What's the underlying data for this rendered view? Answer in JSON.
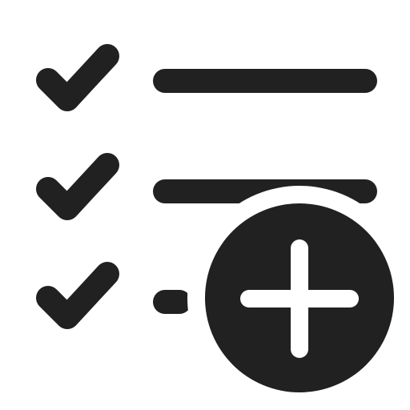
{
  "icon": {
    "name": "task-list-add-icon",
    "glyph_color": "#212121",
    "background_color": "#ffffff",
    "rows": [
      {
        "check": "checkmark-icon",
        "line": "full"
      },
      {
        "check": "checkmark-icon",
        "line": "full-partially-covered"
      },
      {
        "check": "checkmark-icon",
        "line": "short"
      }
    ],
    "badge": "add-circle-icon"
  }
}
